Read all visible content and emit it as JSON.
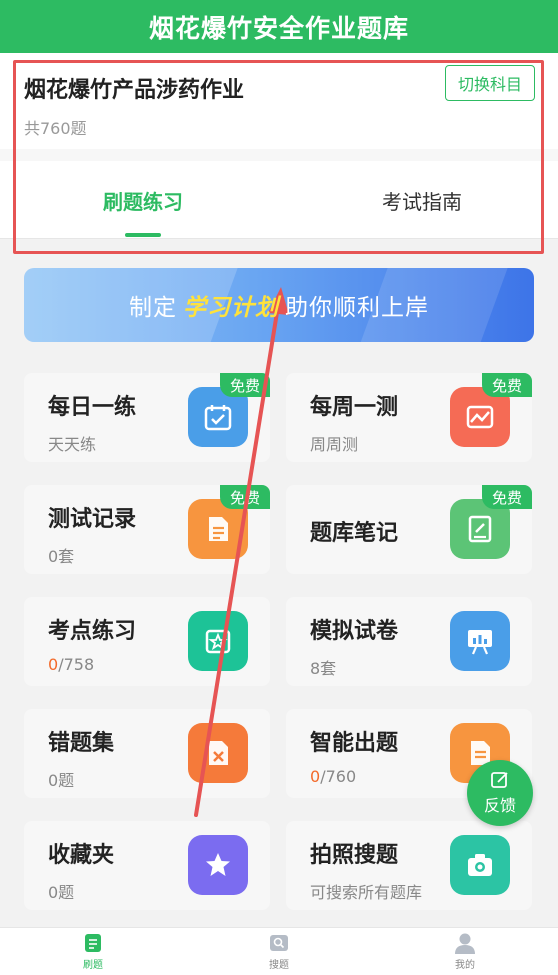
{
  "header": {
    "title": "烟花爆竹安全作业题库"
  },
  "subject": {
    "name": "烟花爆竹产品涉药作业",
    "count": "共760题",
    "switch_label": "切换科目"
  },
  "tabs": [
    {
      "label": "刷题练习"
    },
    {
      "label": "考试指南"
    }
  ],
  "banner": {
    "prefix": "制定",
    "highlight": "学习计划",
    "suffix": "助你顺利上岸"
  },
  "free_badge": "免费",
  "cards": [
    {
      "title": "每日一练",
      "sub": "天天练",
      "icon": "calendar-check-icon",
      "color": "#4a9ee8"
    },
    {
      "title": "每周一测",
      "sub": "周周测",
      "icon": "chart-image-icon",
      "color": "#f56b55"
    },
    {
      "title": "测试记录",
      "sub": "0套",
      "icon": "document-icon",
      "color": "#f7953f"
    },
    {
      "title": "题库笔记",
      "sub": "",
      "icon": "note-edit-icon",
      "color": "#5cc476"
    },
    {
      "title": "考点练习",
      "sub_hot": "0",
      "sub_rest": "/758",
      "icon": "star-board-icon",
      "color": "#1dc397"
    },
    {
      "title": "模拟试卷",
      "sub": "8套",
      "icon": "presentation-icon",
      "color": "#4a9ee8"
    },
    {
      "title": "错题集",
      "sub": "0题",
      "icon": "error-file-icon",
      "color": "#f57a3a"
    },
    {
      "title": "智能出题",
      "sub_hot": "0",
      "sub_rest": "/760",
      "icon": "smart-doc-icon",
      "color": "#f7953f"
    },
    {
      "title": "收藏夹",
      "sub": "0题",
      "icon": "star-icon",
      "color": "#7b6cf0"
    },
    {
      "title": "拍照搜题",
      "sub": "可搜索所有题库",
      "icon": "camera-icon",
      "color": "#2cc4a4"
    }
  ],
  "feedback_label": "反馈",
  "nav": [
    {
      "label": "刷题",
      "icon": "practice-icon"
    },
    {
      "label": "搜题",
      "icon": "search-image-icon"
    },
    {
      "label": "我的",
      "icon": "user-icon"
    }
  ],
  "colors": {
    "brand": "#2dbb62",
    "highlight_box": "#e65454",
    "hot_number": "#f36b2c"
  }
}
